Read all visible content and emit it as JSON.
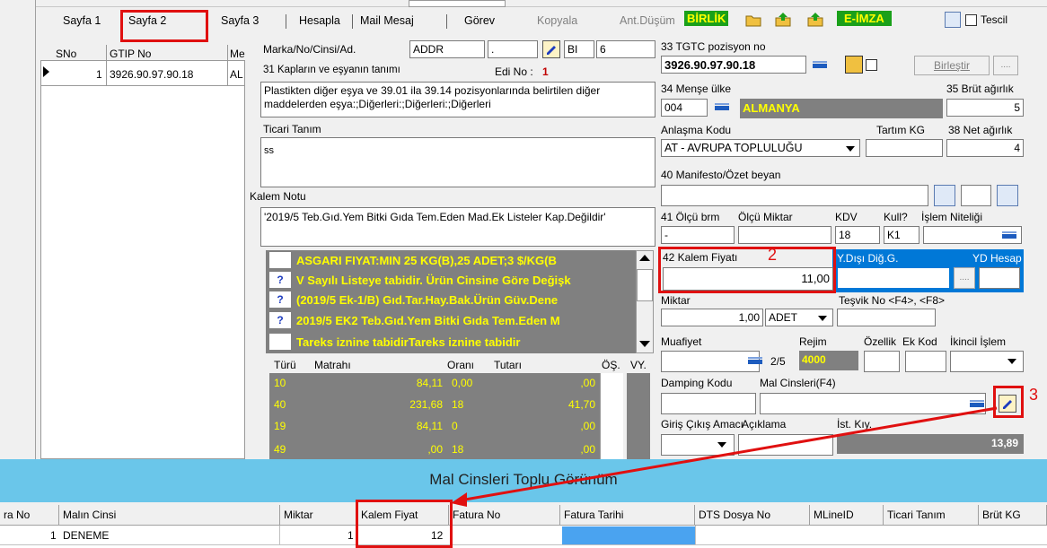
{
  "tabs": {
    "sayfa1": "Sayfa 1",
    "sayfa2": "Sayfa 2",
    "sayfa3": "Sayfa 3",
    "hesapla": "Hesapla",
    "mail": "Mail Mesaj",
    "gorev": "Görev",
    "kopyala": "Kopyala",
    "ant": "Ant.Düşüm",
    "birlik": "BİRLİK",
    "eimza": "E-İMZA",
    "tescil": "Tescil"
  },
  "left_grid": {
    "headers": [
      "SNo",
      "GTIP No",
      "Me"
    ],
    "row": {
      "sno": "1",
      "gtip": "3926.90.97.90.18",
      "me": "AL"
    }
  },
  "form": {
    "marka_label": "Marka/No/Cinsi/Ad.",
    "marka_value": "ADDR",
    "marka_dot": ".",
    "marka_b1": "BI",
    "marka_b2": "6",
    "kap_label": "31 Kapların ve eşyanın tanımı",
    "edi_label": "Edi No :",
    "edi_value": "1",
    "kap_text": "Plastikten diğer eşya ve 39.01 ila 39.14 pozisyonlarında belirtilen diğer maddelerden eşya:;Diğerleri:;Diğerleri:;Diğerleri",
    "ticari_label": "Ticari Tanım",
    "ticari_value": "ss",
    "kalem_notu_label": "Kalem Notu",
    "kalem_notu_value": "'2019/5 Teb.Gıd.Yem Bitki Gıda Tem.Eden Mad.Ek Listeler Kap.Değildir'",
    "warnings": [
      {
        "mark": "",
        "text": "ASGARI FIYAT:MIN 25 KG(B),25 ADET;3 $/KG(B"
      },
      {
        "mark": "?",
        "text": "V Sayılı Listeye tabidir. Ürün Cinsine Göre Değişk"
      },
      {
        "mark": "?",
        "text": "(2019/5 Ek-1/B) Gıd.Tar.Hay.Bak.Ürün Güv.Dene"
      },
      {
        "mark": "?",
        "text": "2019/5 EK2 Teb.Gıd.Yem Bitki Gıda Tem.Eden M"
      },
      {
        "mark": "",
        "text": "Tareks iznine tabidirTareks iznine tabidir"
      }
    ],
    "tax_headers": [
      "Türü",
      "Matrahı",
      "Oranı",
      "Tutarı",
      "ÖŞ.",
      "VY."
    ],
    "tax_rows": [
      {
        "turu": "10",
        "matrah": "84,11",
        "oran": "0,00",
        "tutar": ",00"
      },
      {
        "turu": "40",
        "matrah": "231,68",
        "oran": "18",
        "tutar": "41,70"
      },
      {
        "turu": "19",
        "matrah": "84,11",
        "oran": "0",
        "tutar": ",00"
      },
      {
        "turu": "49",
        "matrah": ",00",
        "oran": "18",
        "tutar": ",00"
      }
    ],
    "tgtc_label": "33 TGTC pozisyon no",
    "tgtc_value": "3926.90.97.90.18",
    "birlestir": "Birleştir",
    "dots": "....",
    "mense_label": "34 Menşe ülke",
    "mense_code": "004",
    "mense_name": "ALMANYA",
    "brut_label": "35 Brüt ağırlık",
    "brut_value": "5",
    "anlasma_label": "Anlaşma Kodu",
    "anlasma_value": "AT   - AVRUPA TOPLULUĞU",
    "tartim_label": "Tartım KG",
    "net_label": "38 Net ağırlık",
    "net_value": "4",
    "manifesto_label": "40 Manifesto/Özet beyan",
    "olcu_label": "41 Ölçü brm",
    "olcu_miktar_label": "Ölçü Miktar",
    "kdv_label": "KDV",
    "kull_label": "Kull?",
    "islem_label": "İşlem Niteliği",
    "olcu_value": "-",
    "kdv_value": "18",
    "kull_value": "K1",
    "kalem_fiyat_label": "42 Kalem Fiyatı",
    "kalem_fiyat_value": "11,00",
    "ydisi_label": "Y.Dışı Diğ.G.",
    "yd_hesap_label": "YD Hesap",
    "miktar_label": "Miktar",
    "miktar_value": "1,00",
    "birim_value": "ADET",
    "tesvik_label": "Teşvik No <F4>, <F8>",
    "muafiyet_label": "Muafiyet",
    "rejim_label": "Rejim",
    "rejim_frac": "2/5",
    "rejim_value": "4000",
    "ozellik_label": "Özellik",
    "ek_kod_label": "Ek Kod",
    "ikincil_label": "İkincil İşlem",
    "damping_label": "Damping Kodu",
    "mal_cinsleri_label": "Mal Cinsleri(F4)",
    "giris_label": "Giriş Çıkış Amacı",
    "aciklama_label": "Açıklama",
    "ist_kiy_label": "İst. Kıy.",
    "ist_kiy_value": "13,89"
  },
  "annotations": {
    "n1": "1",
    "n2": "2",
    "n3": "3"
  },
  "bottom": {
    "title": "Mal Cinsleri Toplu Görünüm",
    "headers": [
      "ra No",
      "Malın Cinsi",
      "Miktar",
      "Kalem Fiyat",
      "Fatura No",
      "Fatura Tarihi",
      "DTS Dosya No",
      "MLineID",
      "Ticari Tanım",
      "Brüt KG"
    ],
    "row": {
      "no": "1",
      "cinsi": "DENEME",
      "miktar": "1",
      "kalem_fiyat": "12"
    }
  },
  "colors": {
    "accent_blue": "#0078d7",
    "gray_panel": "#808080",
    "yellow_text": "#ffff00",
    "red_annotation": "#e01010",
    "title_bar": "#6ac6ea"
  }
}
